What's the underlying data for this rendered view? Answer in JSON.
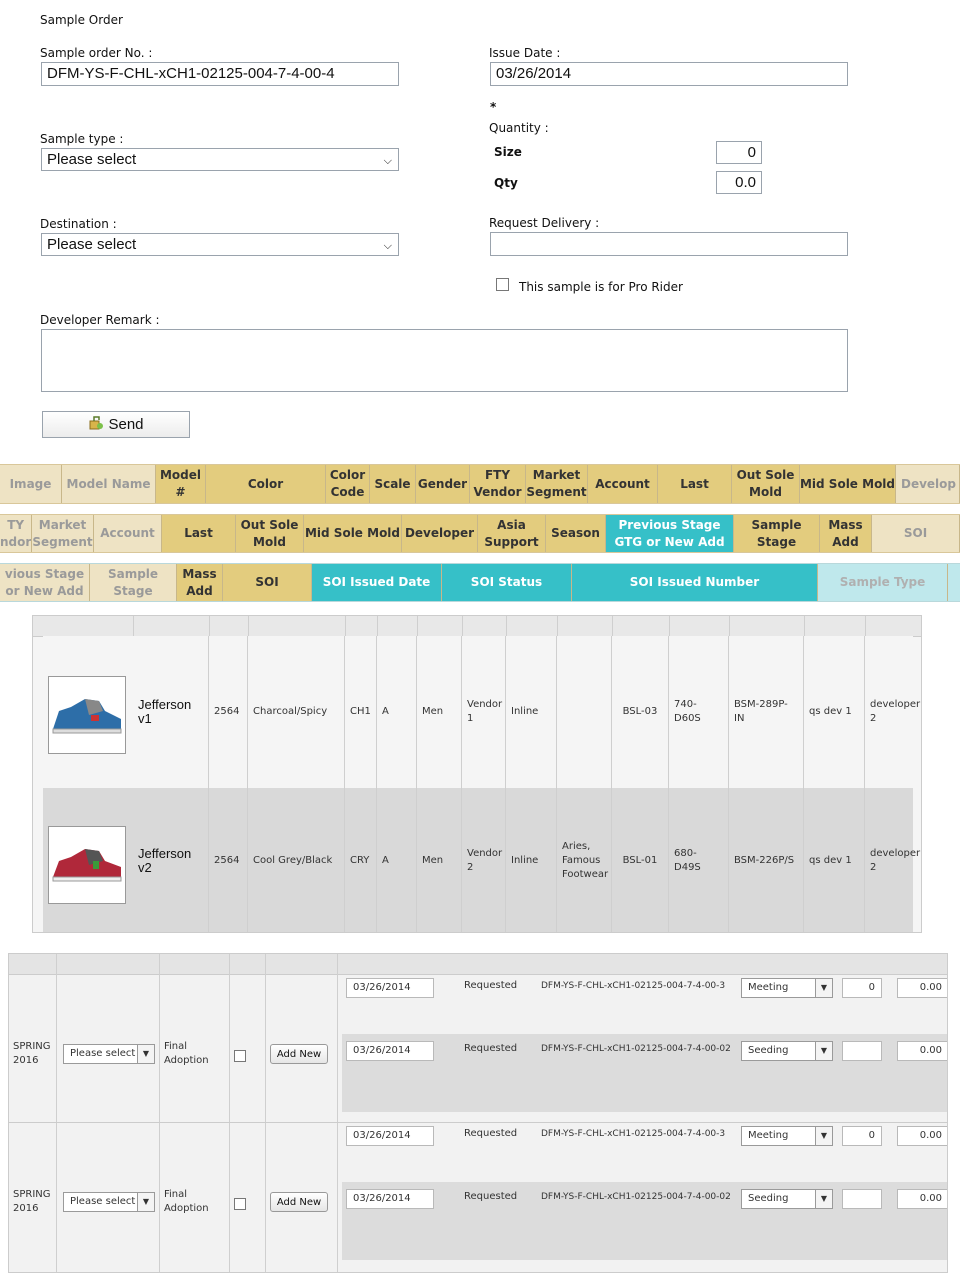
{
  "form": {
    "title": "Sample Order",
    "order_no_label": "Sample order No. :",
    "order_no_value": "DFM-YS-F-CHL-xCH1-02125-004-7-4-00-4",
    "issue_date_label": "Issue Date :",
    "issue_date_value": "03/26/2014",
    "asterisk": "*",
    "sample_type_label": "Sample type :",
    "sample_type_value": "Please select",
    "quantity_label": "Quantity :",
    "size_label": "Size",
    "size_value": "0",
    "qty_label": "Qty",
    "qty_value": "0.0",
    "destination_label": "Destination :",
    "destination_value": "Please select",
    "request_delivery_label": "Request Delivery :",
    "request_delivery_value": "",
    "pro_rider_label": "This sample is for Pro Rider",
    "developer_remark_label": "Developer Remark :",
    "developer_remark_value": "",
    "send_label": "Send"
  },
  "header1": [
    "Image",
    "Model Name",
    "Model #",
    "Color",
    "Color Code",
    "Scale",
    "Gender",
    "FTY Vendor",
    "Market Segment",
    "Account",
    "Last",
    "Out Sole Mold",
    "Mid Sole Mold",
    "Develop"
  ],
  "header2": [
    "TY ndor",
    "Market Segment",
    "Account",
    "Last",
    "Out Sole Mold",
    "Mid Sole Mold",
    "Developer",
    "Asia Support",
    "Season",
    "Previous Stage GTG or New Add",
    "Sample Stage",
    "Mass Add",
    "SOI"
  ],
  "header3": [
    "vious Stage or New Add",
    "Sample Stage",
    "Mass Add",
    "SOI",
    "SOI Issued Date",
    "SOI Status",
    "SOI Issued Number",
    "Sample Type"
  ],
  "products": [
    {
      "model_name": "Jefferson v1",
      "model_no": "2564",
      "color": "Charcoal/Spicy",
      "color_code": "CH1",
      "scale": "A",
      "gender": "Men",
      "vendor": "Vendor 1",
      "segment": "Inline",
      "account": "",
      "last": "BSL-03",
      "out_sole": "740-D60S",
      "mid_sole": "BSM-289P-IN",
      "developer": "qs dev 1",
      "asia": "developer 2"
    },
    {
      "model_name": "Jefferson v2",
      "model_no": "2564",
      "color": "Cool Grey/Black",
      "color_code": "CRY",
      "scale": "A",
      "gender": "Men",
      "vendor": "Vendor 2",
      "segment": "Inline",
      "account": "Aries, Famous Footwear",
      "last": "BSL-01",
      "out_sole": "680-D49S",
      "mid_sole": "BSM-226P/S",
      "developer": "qs dev 1",
      "asia": "developer 2"
    }
  ],
  "lower": {
    "season": "SPRING 2016",
    "prev_stage": "Please select",
    "sample_stage": "Final Adoption",
    "add_new": "Add New",
    "rows": [
      {
        "date": "03/26/2014",
        "status": "Requested",
        "number": "DFM-YS-F-CHL-xCH1-02125-004-7-4-00-3",
        "type": "Meeting",
        "size": "0",
        "qty": "0.00"
      },
      {
        "date": "03/26/2014",
        "status": "Requested",
        "number": "DFM-YS-F-CHL-xCH1-02125-004-7-4-00-02",
        "type": "Seeding",
        "size": "",
        "qty": "0.00"
      },
      {
        "date": "03/26/2014",
        "status": "Requested",
        "number": "DFM-YS-F-CHL-xCH1-02125-004-7-4-00-3",
        "type": "Meeting",
        "size": "0",
        "qty": "0.00"
      },
      {
        "date": "03/26/2014",
        "status": "Requested",
        "number": "DFM-YS-F-CHL-xCH1-02125-004-7-4-00-02",
        "type": "Seeding",
        "size": "",
        "qty": "0.00"
      }
    ]
  }
}
